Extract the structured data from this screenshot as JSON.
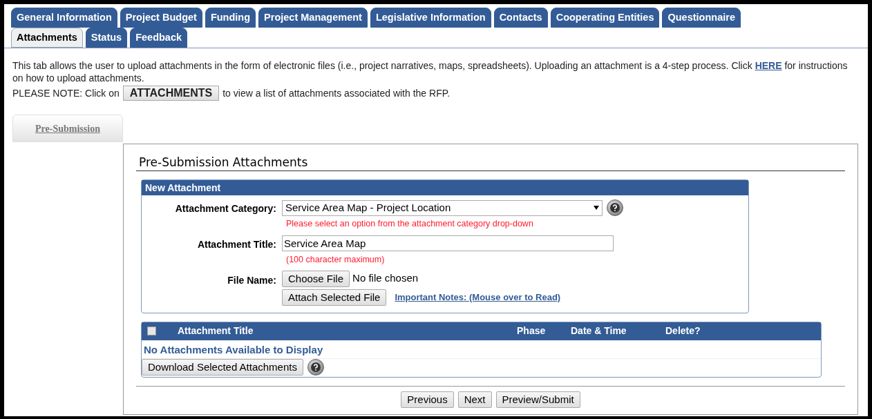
{
  "tab_rows": [
    [
      {
        "label": "General Information",
        "selected": false
      },
      {
        "label": "Project Budget",
        "selected": false
      },
      {
        "label": "Funding",
        "selected": false
      },
      {
        "label": "Project Management",
        "selected": false
      },
      {
        "label": "Legislative Information",
        "selected": false
      },
      {
        "label": "Contacts",
        "selected": false
      },
      {
        "label": "Cooperating Entities",
        "selected": false
      },
      {
        "label": "Questionnaire",
        "selected": false
      }
    ],
    [
      {
        "label": "Attachments",
        "selected": true
      },
      {
        "label": "Status",
        "selected": false
      },
      {
        "label": "Feedback",
        "selected": false
      }
    ]
  ],
  "intro": {
    "before": "This tab allows the user to upload attachments in the form of electronic files (i.e., project narratives, maps, spreadsheets). Uploading an attachment is a 4-step process. Click",
    "link": "HERE",
    "after": "for instructions on how to upload attachments."
  },
  "note": {
    "before": "PLEASE NOTE: Click on",
    "button": "ATTACHMENTS",
    "after": "to view a list of attachments associated with the RFP."
  },
  "subtabs": [
    {
      "label": "Pre-Submission",
      "selected": true
    }
  ],
  "section_title": "Pre-Submission Attachments",
  "new_attachment": {
    "title": "New Attachment",
    "category": {
      "label": "Attachment Category:",
      "value": "Service Area Map - Project Location",
      "error": "Please select an option from the attachment category drop-down"
    },
    "title_field": {
      "label": "Attachment Title:",
      "value": "Service Area Map",
      "hint": "(100 character maximum)"
    },
    "file": {
      "label": "File Name:",
      "button": "Choose File",
      "status": "No file chosen"
    },
    "attach_button": "Attach Selected File",
    "notes_link": "Important Notes: (Mouse over to Read)"
  },
  "table": {
    "select_all": {
      "checked": false
    },
    "columns": [
      "Attachment Title",
      "Phase",
      "Date & Time",
      "Delete?"
    ],
    "empty": "No Attachments Available to Display",
    "download_button": "Download Selected Attachments"
  },
  "nav_buttons": [
    "Previous",
    "Next",
    "Preview/Submit"
  ]
}
